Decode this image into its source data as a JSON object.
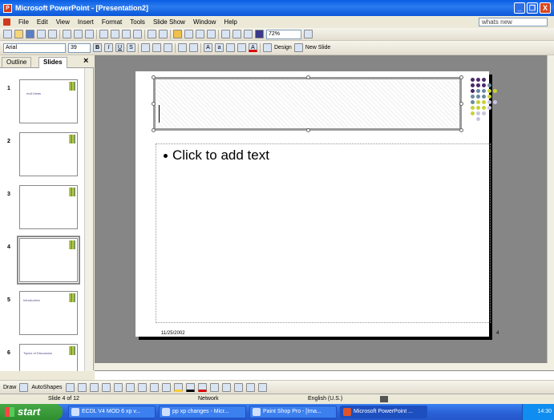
{
  "window": {
    "title": "Microsoft PowerPoint - [Presentation2]",
    "app_icon_letter": "P",
    "minimize": "_",
    "restore": "❐",
    "close": "X"
  },
  "menu": {
    "items": [
      "File",
      "Edit",
      "View",
      "Insert",
      "Format",
      "Tools",
      "Slide Show",
      "Window",
      "Help"
    ],
    "help_box": "whats new"
  },
  "toolbar": {
    "zoom": "72%",
    "font": "Arial",
    "font_size": "39",
    "design_label": "Design",
    "new_slide_label": "New Slide"
  },
  "panel": {
    "tab_outline": "Outline",
    "tab_slides": "Slides",
    "close": "×",
    "slides": [
      {
        "num": "1",
        "title": "ecdl ideas",
        "body": "",
        "footer": ""
      },
      {
        "num": "2",
        "title": "",
        "body": "",
        "footer": ""
      },
      {
        "num": "3",
        "title": "",
        "body": "",
        "footer": ""
      },
      {
        "num": "4",
        "title": "",
        "body": "",
        "footer": ""
      },
      {
        "num": "5",
        "title": "Introduction",
        "body": "",
        "footer": ""
      },
      {
        "num": "6",
        "title": "Topics of Discussion",
        "body": "",
        "footer": ""
      }
    ]
  },
  "slide": {
    "body_placeholder": "Click to add text",
    "footer_date": "11/25/2002",
    "slide_number": "4"
  },
  "draw": {
    "draw_label": "Draw",
    "autoshapes_label": "AutoShapes"
  },
  "status": {
    "slide_of": "Slide 4 of 12",
    "design": "Network",
    "language": "English (U.S.)"
  },
  "taskbar": {
    "start": "start",
    "buttons": [
      "ECDL V4 MOD 6 xp v...",
      "pp xp changes - Micr...",
      "Paint Shop Pro - [Ima...",
      "Microsoft PowerPoint ..."
    ],
    "clock": "14:30"
  }
}
